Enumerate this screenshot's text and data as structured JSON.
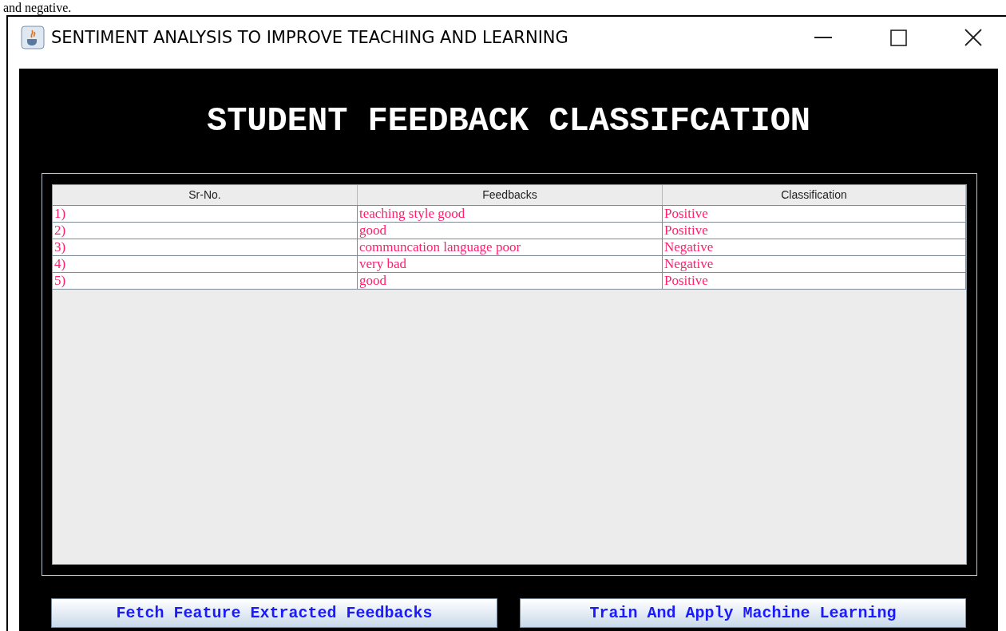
{
  "page_text": "and negative.",
  "window": {
    "title": "SENTIMENT ANALYSIS TO IMPROVE TEACHING AND LEARNING"
  },
  "heading": "STUDENT FEEDBACK CLASSIFCATION",
  "table": {
    "columns": [
      "Sr-No.",
      "Feedbacks",
      "Classification"
    ],
    "rows": [
      [
        "1)",
        "teaching style good",
        "Positive"
      ],
      [
        "2)",
        "good",
        "Positive"
      ],
      [
        "3)",
        "communcation language poor",
        "Negative"
      ],
      [
        "4)",
        "very bad",
        "Negative"
      ],
      [
        "5)",
        "good",
        "Positive"
      ]
    ]
  },
  "buttons": [
    "Fetch Feature Extracted Feedbacks",
    "Train And Apply Machine Learning"
  ]
}
